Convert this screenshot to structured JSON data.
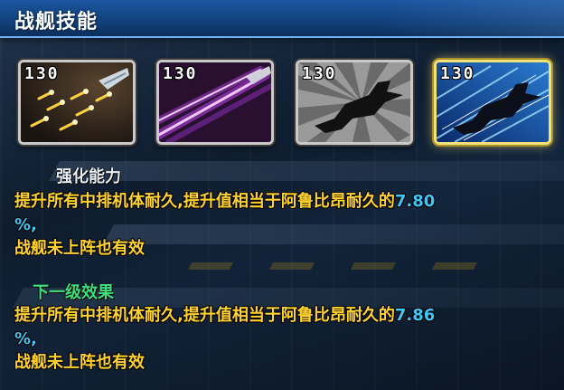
{
  "header": {
    "title": "战舰技能"
  },
  "skills": [
    {
      "level": "130",
      "icon": "missile-barrage-icon",
      "selected": false
    },
    {
      "level": "130",
      "icon": "laser-beam-icon",
      "selected": false
    },
    {
      "level": "130",
      "icon": "ship-silhouette-burst-icon",
      "selected": false
    },
    {
      "level": "130",
      "icon": "ship-silhouette-speed-icon",
      "selected": true
    }
  ],
  "current": {
    "heading": "强化能力",
    "text_before": "提升所有中排机体耐久,提升值相当于阿鲁比昂耐久的",
    "value": "7.80",
    "text_after": "%,",
    "line2": "战舰未上阵也有效"
  },
  "next": {
    "heading": "下一级效果",
    "text_before": "提升所有中排机体耐久,提升值相当于阿鲁比昂耐久的",
    "value": "7.86",
    "text_after": "%,",
    "line2": "战舰未上阵也有效"
  },
  "colors": {
    "heading_current": "#e8eef5",
    "heading_next": "#3fe07a",
    "body_text": "#ffd22e",
    "value": "#3ec6f5",
    "selected_border": "#f2e27a"
  }
}
